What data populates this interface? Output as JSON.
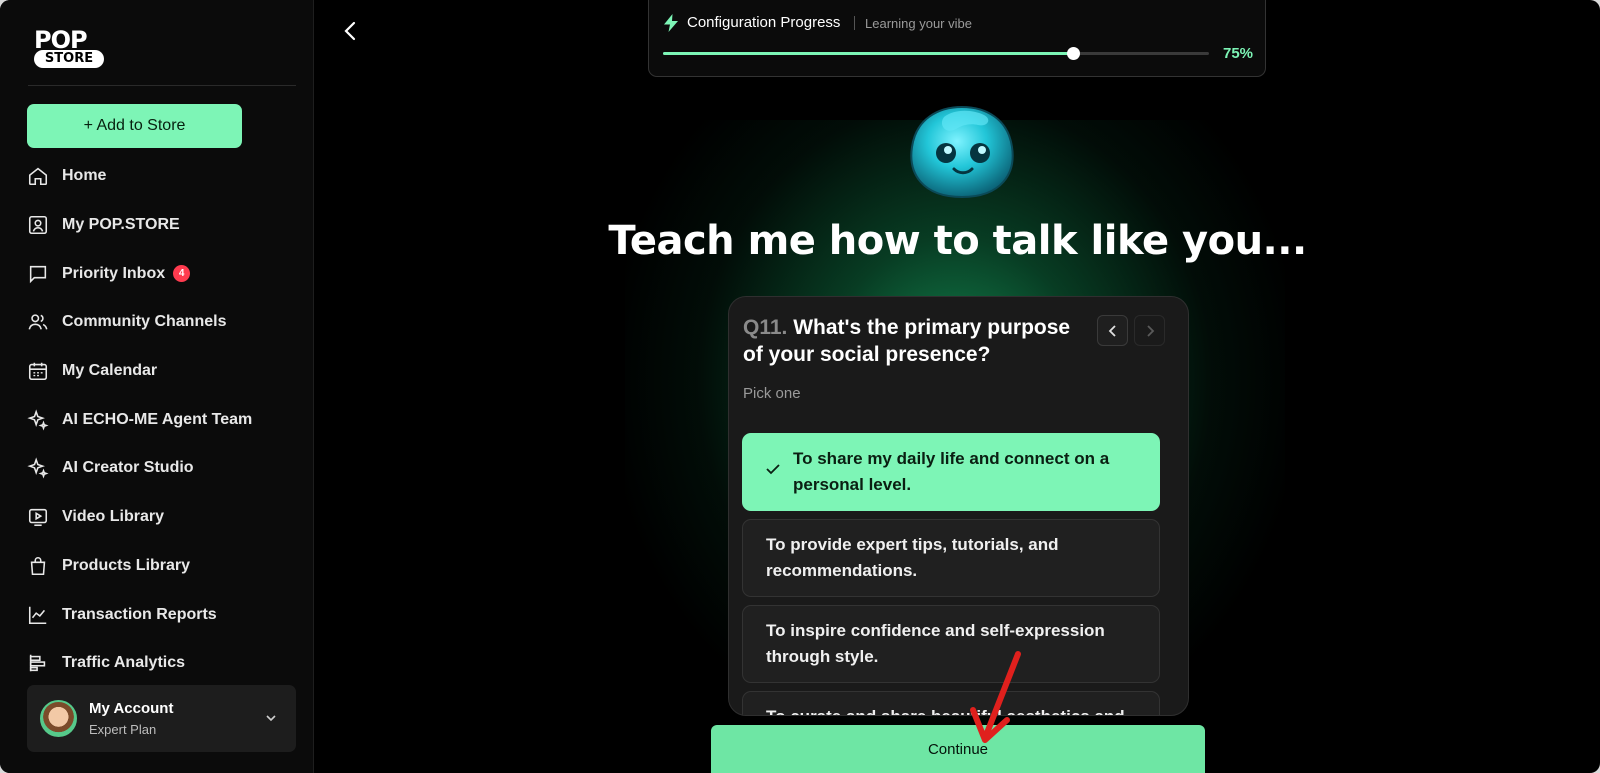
{
  "logo": {
    "top": "POP",
    "bottom": "STORE"
  },
  "sidebar": {
    "add_button": "+ Add to Store",
    "items": [
      {
        "label": "Home",
        "icon": "home-icon"
      },
      {
        "label": "My POP.STORE",
        "icon": "profile-icon"
      },
      {
        "label": "Priority Inbox",
        "icon": "chat-icon",
        "badge": "4"
      },
      {
        "label": "Community Channels",
        "icon": "users-icon"
      },
      {
        "label": "My Calendar",
        "icon": "calendar-icon"
      },
      {
        "label": "AI ECHO-ME Agent Team",
        "icon": "sparkle-icon"
      },
      {
        "label": "AI Creator Studio",
        "icon": "sparkle-icon"
      },
      {
        "label": "Video Library",
        "icon": "video-icon"
      },
      {
        "label": "Products Library",
        "icon": "bag-icon"
      },
      {
        "label": "Transaction Reports",
        "icon": "line-chart-icon"
      },
      {
        "label": "Traffic Analytics",
        "icon": "bars-icon"
      }
    ],
    "account": {
      "name": "My Account",
      "plan": "Expert Plan"
    }
  },
  "progress": {
    "title": "Configuration Progress",
    "subtitle": "Learning your vibe",
    "percent_label": "75%",
    "value": 0.75,
    "accent": "#7df5b6"
  },
  "headline": "Teach me how to talk like you...",
  "question": {
    "number": "Q11.",
    "text": "What's the primary purpose of your social presence?",
    "hint": "Pick one",
    "options": [
      {
        "label": "To share my daily life and connect on a personal level.",
        "selected": true
      },
      {
        "label": "To provide expert tips, tutorials, and recommendations.",
        "selected": false
      },
      {
        "label": "To inspire confidence and self-expression through style.",
        "selected": false
      },
      {
        "label": "To curate and share beautiful aesthetics and",
        "selected": false
      }
    ]
  },
  "continue_label": "Continue"
}
